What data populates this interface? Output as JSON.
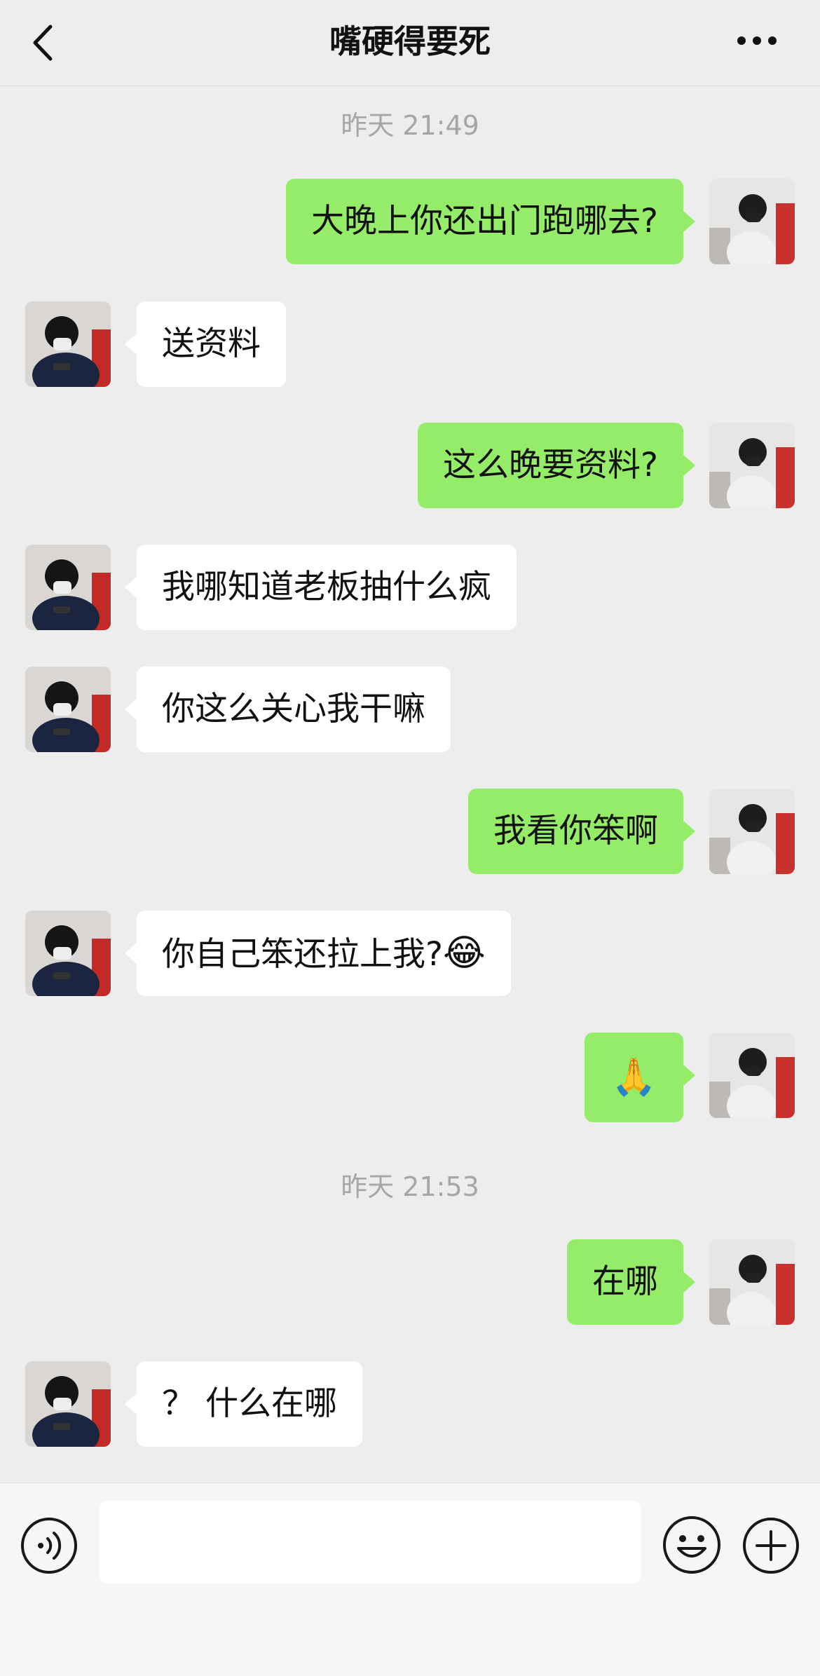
{
  "header": {
    "title": "嘴硬得要死",
    "back_icon": "chevron-left-icon",
    "more_icon": "more-dots-icon"
  },
  "timestamps": [
    "昨天 21:49",
    "昨天 21:53"
  ],
  "messages": [
    {
      "sender": "me",
      "text": "大晚上你还出门跑哪去?"
    },
    {
      "sender": "them",
      "text": "送资料"
    },
    {
      "sender": "me",
      "text": "这么晚要资料?"
    },
    {
      "sender": "them",
      "text": "我哪知道老板抽什么疯"
    },
    {
      "sender": "them",
      "text": "你这么关心我干嘛"
    },
    {
      "sender": "me",
      "text": "我看你笨啊"
    },
    {
      "sender": "them",
      "text": "你自己笨还拉上我?",
      "emoji": "😂"
    },
    {
      "sender": "me",
      "text": "",
      "emoji": "🙏"
    },
    {
      "sender": "me",
      "text": "在哪"
    },
    {
      "sender": "them",
      "text": "？ 什么在哪"
    }
  ],
  "input_bar": {
    "voice_icon": "voice-icon",
    "emoji_icon": "emoji-face-icon",
    "plus_icon": "plus-circle-icon",
    "text_value": ""
  },
  "colors": {
    "background": "#ededed",
    "my_bubble": "#95ec69",
    "their_bubble": "#ffffff",
    "timestamp": "#a6a6a6"
  }
}
